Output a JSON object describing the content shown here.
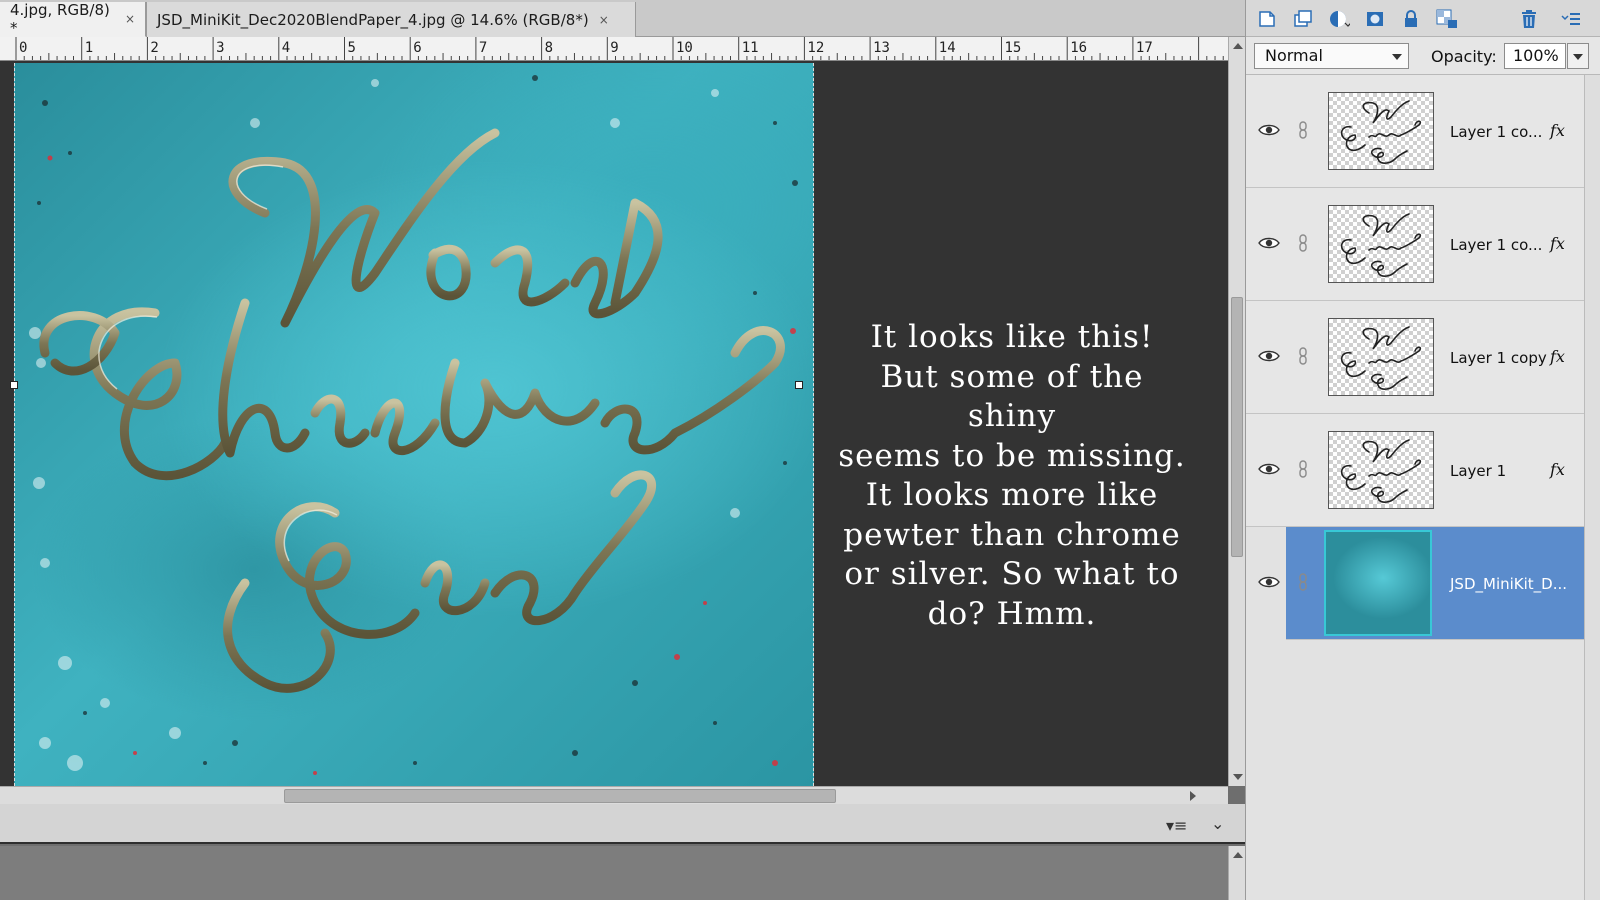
{
  "tabs": [
    {
      "label": "4.jpg, RGB/8) *",
      "close": "×",
      "active": true
    },
    {
      "label": "JSD_MiniKit_Dec2020BlendPaper_4.jpg @ 14.6% (RGB/8*)",
      "close": "×",
      "active": false
    }
  ],
  "ruler": {
    "numbers": [
      "0",
      "1",
      "2",
      "3",
      "4",
      "5",
      "6",
      "7",
      "8",
      "9",
      "10",
      "11",
      "12",
      "13",
      "14",
      "15",
      "16",
      "17"
    ]
  },
  "canvas": {
    "artwork_lettering": "Worst Christmas Ever",
    "caption_lines": [
      "It looks like this!",
      "But some of the shiny",
      "seems to be missing.",
      "It looks more like",
      "pewter than chrome",
      "or silver. So what to",
      "do? Hmm."
    ]
  },
  "layers_panel": {
    "blend_mode": "Normal",
    "opacity_label": "Opacity:",
    "opacity_value": "100%",
    "toolbar_icons": [
      "new-layer-icon",
      "new-group-icon",
      "adjustment-layer-icon",
      "layer-mask-icon",
      "lock-all-icon",
      "lock-transparency-icon",
      "delete-layer-icon",
      "panel-menu-icon"
    ],
    "fx_label": "fx",
    "layers": [
      {
        "name": "Layer 1 co...",
        "has_fx": true,
        "selected": false
      },
      {
        "name": "Layer 1 co...",
        "has_fx": true,
        "selected": false
      },
      {
        "name": "Layer 1 copy",
        "has_fx": true,
        "selected": false
      },
      {
        "name": "Layer 1",
        "has_fx": true,
        "selected": false
      },
      {
        "name": "JSD_MiniKit_D...",
        "has_fx": false,
        "selected": true
      }
    ]
  },
  "colors": {
    "canvas_bg": "#333333",
    "paper_teal": "#3fb2c0",
    "lettering_pewter": "#8a8462",
    "selected_layer": "#5b8ccc",
    "accent_blue": "#2a6db5"
  }
}
